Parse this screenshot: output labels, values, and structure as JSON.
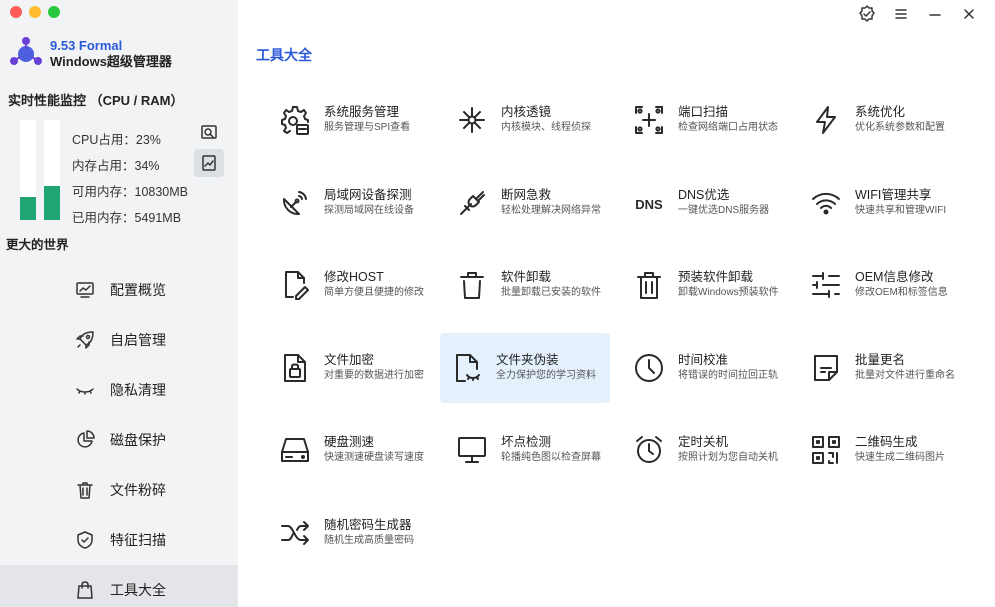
{
  "app": {
    "version": "9.53 Formal",
    "name": "Windows超级管理器"
  },
  "performance": {
    "title": "实时性能监控 （CPU / RAM）",
    "cpu_percent": 23,
    "mem_percent": 34,
    "cpu_label": "CPU占用：23%",
    "mem_label": "内存占用：34%",
    "avail_label": "可用内存：10830MB",
    "used_label": "已用内存：5491MB"
  },
  "sidebar": {
    "world_label": "更大的世界",
    "items": [
      {
        "label": "配置概览",
        "icon": "monitor-chart-icon"
      },
      {
        "label": "自启管理",
        "icon": "rocket-icon"
      },
      {
        "label": "隐私清理",
        "icon": "closed-eye-icon"
      },
      {
        "label": "磁盘保护",
        "icon": "pie-chart-icon"
      },
      {
        "label": "文件粉碎",
        "icon": "trash-icon"
      },
      {
        "label": "特征扫描",
        "icon": "shield-check-icon"
      },
      {
        "label": "工具大全",
        "icon": "bag-icon",
        "active": true
      }
    ]
  },
  "main": {
    "section_title": "工具大全",
    "tools": [
      {
        "title": "系统服务管理",
        "desc": "服务管理与SPI查看",
        "icon": "gear-service-icon"
      },
      {
        "title": "内核透镜",
        "desc": "内核模块、线程侦探",
        "icon": "molecule-icon"
      },
      {
        "title": "端口扫描",
        "desc": "检查网络端口占用状态",
        "icon": "port-scan-icon"
      },
      {
        "title": "系统优化",
        "desc": "优化系统参数和配置",
        "icon": "lightning-icon"
      },
      {
        "title": "局域网设备探测",
        "desc": "探测局域网在线设备",
        "icon": "satellite-dish-icon"
      },
      {
        "title": "断网急救",
        "desc": "轻松处理解决网络异常",
        "icon": "plug-icon"
      },
      {
        "title": "DNS优选",
        "desc": "一键优选DNS服务器",
        "icon": "dns-icon"
      },
      {
        "title": "WIFI管理共享",
        "desc": "快速共享和管理WIFI",
        "icon": "wifi-icon"
      },
      {
        "title": "修改HOST",
        "desc": "简单方便且便捷的修改",
        "icon": "file-edit-icon"
      },
      {
        "title": "软件卸载",
        "desc": "批量卸载已安装的软件",
        "icon": "trash-icon"
      },
      {
        "title": "预装软件卸载",
        "desc": "卸载Windows预装软件",
        "icon": "trash-lines-icon"
      },
      {
        "title": "OEM信息修改",
        "desc": "修改OEM和标签信息",
        "icon": "sliders-icon"
      },
      {
        "title": "文件加密",
        "desc": "对重要的数据进行加密",
        "icon": "file-lock-icon"
      },
      {
        "title": "文件夹伪装",
        "desc": "全力保护您的学习资料",
        "icon": "file-eye-icon",
        "highlight": true
      },
      {
        "title": "时间校准",
        "desc": "将错误的时间拉回正轨",
        "icon": "clock-icon"
      },
      {
        "title": "批量更名",
        "desc": "批量对文件进行重命名",
        "icon": "rename-icon"
      },
      {
        "title": "硬盘测速",
        "desc": "快速测速硬盘读写速度",
        "icon": "harddisk-icon"
      },
      {
        "title": "坏点检测",
        "desc": "轮播纯色图以检查屏幕",
        "icon": "screen-icon"
      },
      {
        "title": "定时关机",
        "desc": "按照计划为您自动关机",
        "icon": "alarm-clock-icon"
      },
      {
        "title": "二维码生成",
        "desc": "快速生成二维码图片",
        "icon": "qrcode-icon"
      },
      {
        "title": "随机密码生成器",
        "desc": "随机生成高质量密码",
        "icon": "shuffle-icon"
      }
    ]
  },
  "colors": {
    "accent": "#2b59d8",
    "bar_fill": "#21a673",
    "highlight_bg": "#e4f1fd",
    "sidebar_bg": "#f2f3f5"
  }
}
